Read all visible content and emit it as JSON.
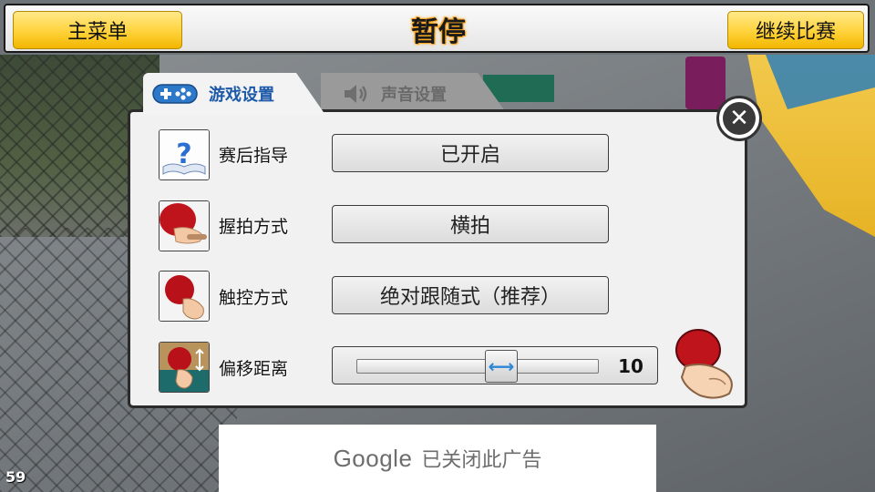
{
  "topbar": {
    "main_menu_label": "主菜单",
    "title": "暂停",
    "continue_label": "继续比赛"
  },
  "tabs": [
    {
      "label": "游戏设置",
      "icon": "gamepad-icon",
      "active": true
    },
    {
      "label": "声音设置",
      "icon": "speaker-icon",
      "active": false
    }
  ],
  "settings": {
    "postgame_guide": {
      "label": "赛后指导",
      "value": "已开启",
      "icon": "help-book-icon"
    },
    "grip_style": {
      "label": "握拍方式",
      "value": "横拍",
      "icon": "paddle-grip-icon"
    },
    "touch_mode": {
      "label": "触控方式",
      "value": "绝对跟随式（推荐）",
      "icon": "touch-paddle-icon"
    },
    "offset_distance": {
      "label": "偏移距离",
      "value": "10",
      "icon": "offset-paddle-icon",
      "fraction": 0.6
    }
  },
  "ad": {
    "brand": "Google",
    "text": "已关闭此广告"
  },
  "fps": "59",
  "colors": {
    "accent_yellow": "#ffd23a",
    "tab_active_text": "#1e5aa8",
    "slider_thumb_arrow": "#2d86d6"
  }
}
